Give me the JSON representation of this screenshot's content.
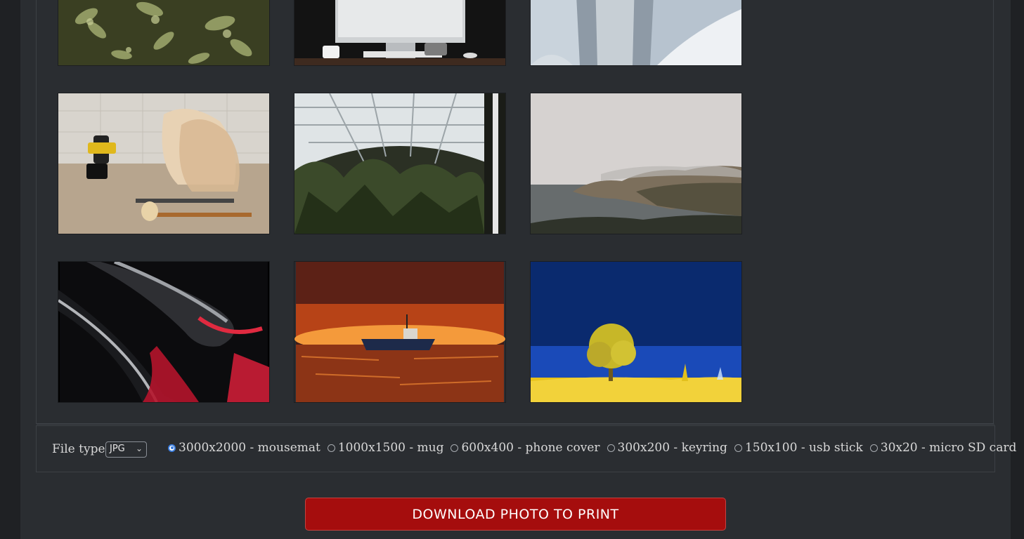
{
  "gallery": {
    "photos": [
      {
        "name": "succulent-leaves"
      },
      {
        "name": "desk-computer"
      },
      {
        "name": "frozen-waterfall"
      },
      {
        "name": "woodworking-tools"
      },
      {
        "name": "glass-greenhouse"
      },
      {
        "name": "foggy-coastline"
      },
      {
        "name": "red-abstract-curves"
      },
      {
        "name": "boat-at-sunset"
      },
      {
        "name": "yellow-tree-blue-sky"
      }
    ],
    "selected_index": 6
  },
  "options": {
    "file_type_label": "File type",
    "file_type_value": "JPG",
    "sizes": [
      {
        "label": "3000x2000 - mousemat",
        "checked": true
      },
      {
        "label": "1000x1500 - mug",
        "checked": false
      },
      {
        "label": "600x400 - phone cover",
        "checked": false
      },
      {
        "label": "300x200 - keyring",
        "checked": false
      },
      {
        "label": "150x100 - usb stick",
        "checked": false
      },
      {
        "label": "30x20 - micro SD card",
        "checked": false
      }
    ]
  },
  "download_button": {
    "label": "DOWNLOAD PHOTO TO PRINT"
  },
  "colors": {
    "accent_button": "#a50d0d",
    "radio_selected": "#3b7ddd"
  }
}
